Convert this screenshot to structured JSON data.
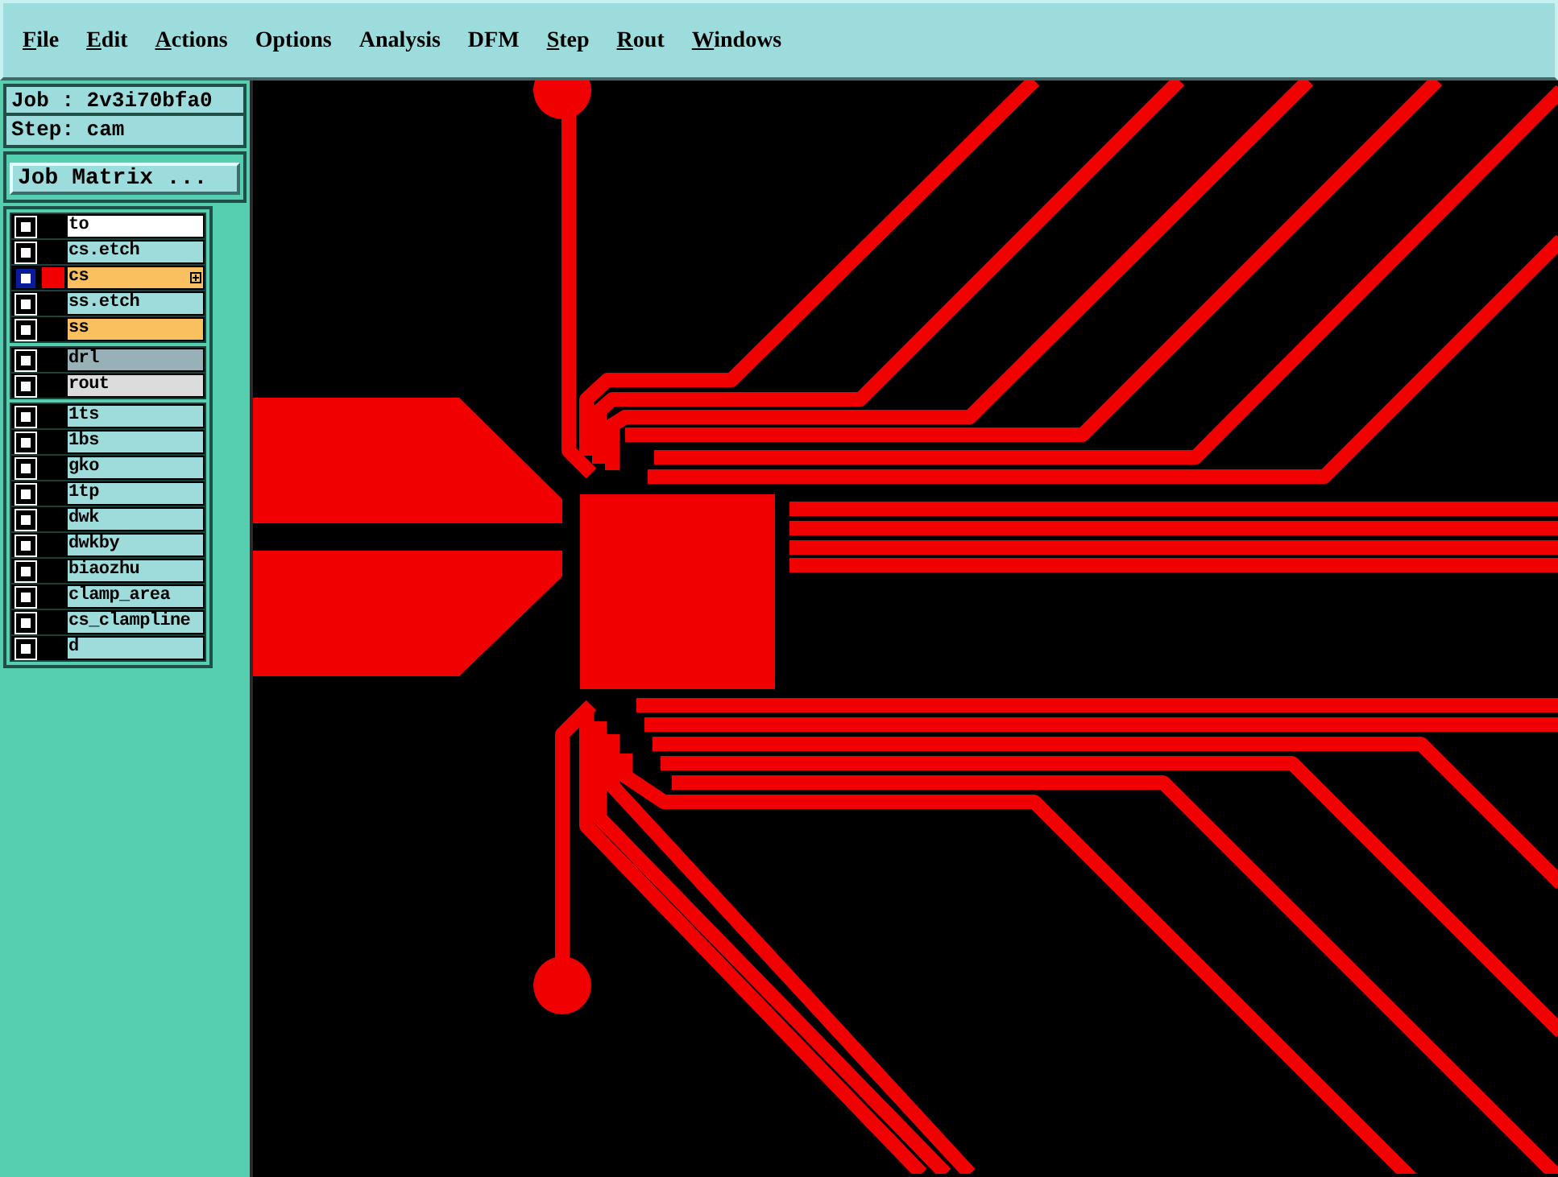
{
  "menu": [
    {
      "label": "File",
      "mnemonic": true
    },
    {
      "label": "Edit",
      "mnemonic": true
    },
    {
      "label": "Actions",
      "mnemonic": true
    },
    {
      "label": "Options",
      "mnemonic": false
    },
    {
      "label": "Analysis",
      "mnemonic": false
    },
    {
      "label": "DFM",
      "mnemonic": false
    },
    {
      "label": "Step",
      "mnemonic": true
    },
    {
      "label": "Rout",
      "mnemonic": true
    },
    {
      "label": "Windows",
      "mnemonic": true
    }
  ],
  "job": "Job : 2v3i70bfa0",
  "step": "Step: cam",
  "job_matrix_button": "Job Matrix ...",
  "layer_groups": [
    [
      {
        "name": "to",
        "color": "#ffffff",
        "selected": false
      },
      {
        "name": "cs.etch",
        "color": "#9edcdc",
        "selected": false
      },
      {
        "name": "cs",
        "color": "#fac060",
        "selected": true
      },
      {
        "name": "ss.etch",
        "color": "#9edcdc",
        "selected": false
      },
      {
        "name": "ss",
        "color": "#fac060",
        "selected": false
      }
    ],
    [
      {
        "name": "drl",
        "color": "#98b0b8",
        "selected": false
      },
      {
        "name": "rout",
        "color": "#dcdcdc",
        "selected": false
      }
    ],
    [
      {
        "name": "1ts",
        "color": "#9edcdc",
        "selected": false
      },
      {
        "name": "1bs",
        "color": "#9edcdc",
        "selected": false
      },
      {
        "name": "gko",
        "color": "#9edcdc",
        "selected": false
      },
      {
        "name": "1tp",
        "color": "#9edcdc",
        "selected": false
      },
      {
        "name": "dwk",
        "color": "#9edcdc",
        "selected": false
      },
      {
        "name": "dwkby",
        "color": "#9edcdc",
        "selected": false
      },
      {
        "name": "biaozhu",
        "color": "#9edcdc",
        "selected": false
      },
      {
        "name": "clamp_area",
        "color": "#9edcdc",
        "selected": false
      },
      {
        "name": "cs_clampline",
        "color": "#9edcdc",
        "selected": false
      },
      {
        "name": "d",
        "color": "#9edcdc",
        "selected": false
      }
    ]
  ]
}
